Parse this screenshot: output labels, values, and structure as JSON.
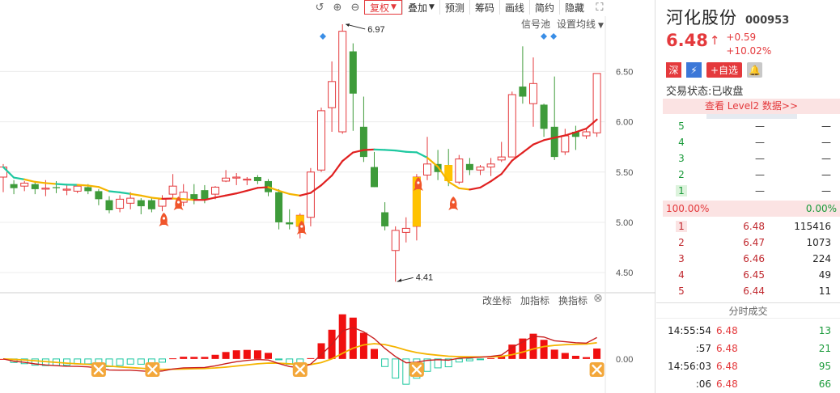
{
  "toolbar": {
    "undo_icon": "undo-icon",
    "zoom_in_icon": "zoom-in-icon",
    "zoom_out_icon": "zoom-out-icon",
    "buttons": [
      "复权",
      "叠加",
      "预测",
      "筹码",
      "画线",
      "简约",
      "隐藏"
    ],
    "fullscreen_icon": "fullscreen-icon"
  },
  "chart_links": {
    "signal_pool": "信号池",
    "ma_settings": "设置均线"
  },
  "indicator_toolbar": {
    "change_axis": "改坐标",
    "add_indicator": "加指标",
    "switch_indicator": "换指标",
    "close_icon": "close-circle-icon"
  },
  "colors": {
    "up": "#e4393c",
    "down": "#3e9b3a",
    "accent": "#e4393c",
    "ma_gold": "#f5b400",
    "ma_teal": "#1ec8a0",
    "dif": "#c81e1e",
    "dea": "#f5b400"
  },
  "chart_data": [
    {
      "type": "candlestick",
      "y_ticks": [
        "6.50",
        "6.00",
        "5.50",
        "5.00",
        "4.50"
      ],
      "ylim": [
        4.3,
        7.05
      ],
      "annotations": {
        "high": "6.97",
        "low": "4.41"
      },
      "candles": [
        {
          "o": 5.45,
          "c": 5.55,
          "h": 5.58,
          "l": 5.3
        },
        {
          "o": 5.38,
          "c": 5.34,
          "h": 5.42,
          "l": 5.28
        },
        {
          "o": 5.36,
          "c": 5.39,
          "h": 5.41,
          "l": 5.31
        },
        {
          "o": 5.38,
          "c": 5.33,
          "h": 5.4,
          "l": 5.28
        },
        {
          "o": 5.33,
          "c": 5.34,
          "h": 5.42,
          "l": 5.26
        },
        {
          "o": 5.35,
          "c": 5.34,
          "h": 5.41,
          "l": 5.29
        },
        {
          "o": 5.32,
          "c": 5.33,
          "h": 5.38,
          "l": 5.27
        },
        {
          "o": 5.31,
          "c": 5.36,
          "h": 5.37,
          "l": 5.29
        },
        {
          "o": 5.35,
          "c": 5.31,
          "h": 5.38,
          "l": 5.28
        },
        {
          "o": 5.31,
          "c": 5.23,
          "h": 5.33,
          "l": 5.17
        },
        {
          "o": 5.22,
          "c": 5.12,
          "h": 5.26,
          "l": 5.09
        },
        {
          "o": 5.14,
          "c": 5.23,
          "h": 5.27,
          "l": 5.1
        },
        {
          "o": 5.19,
          "c": 5.24,
          "h": 5.3,
          "l": 5.13
        },
        {
          "o": 5.22,
          "c": 5.16,
          "h": 5.24,
          "l": 5.08
        },
        {
          "o": 5.22,
          "c": 5.13,
          "h": 5.25,
          "l": 5.1
        },
        {
          "o": 5.16,
          "c": 5.23,
          "h": 5.27,
          "l": 5.11
        },
        {
          "o": 5.28,
          "c": 5.36,
          "h": 5.48,
          "l": 5.24
        },
        {
          "o": 5.2,
          "c": 5.3,
          "h": 5.38,
          "l": 5.16
        },
        {
          "o": 5.28,
          "c": 5.23,
          "h": 5.38,
          "l": 5.18
        },
        {
          "o": 5.32,
          "c": 5.23,
          "h": 5.37,
          "l": 5.19
        },
        {
          "o": 5.28,
          "c": 5.35,
          "h": 5.36,
          "l": 5.23
        },
        {
          "o": 5.41,
          "c": 5.44,
          "h": 5.52,
          "l": 5.4
        },
        {
          "o": 5.44,
          "c": 5.45,
          "h": 5.49,
          "l": 5.37
        },
        {
          "o": 5.42,
          "c": 5.43,
          "h": 5.45,
          "l": 5.37
        },
        {
          "o": 5.45,
          "c": 5.41,
          "h": 5.47,
          "l": 5.38
        },
        {
          "o": 5.41,
          "c": 5.3,
          "h": 5.43,
          "l": 5.26
        },
        {
          "o": 5.3,
          "c": 5.0,
          "h": 5.33,
          "l": 4.93
        },
        {
          "o": 5.0,
          "c": 4.98,
          "h": 5.13,
          "l": 4.93
        },
        {
          "o": 4.96,
          "c": 5.07,
          "h": 5.09,
          "l": 4.84
        },
        {
          "o": 5.05,
          "c": 5.5,
          "h": 5.54,
          "l": 4.96
        },
        {
          "o": 5.52,
          "c": 6.11,
          "h": 6.14,
          "l": 5.5
        },
        {
          "o": 6.14,
          "c": 6.4,
          "h": 6.6,
          "l": 5.9
        },
        {
          "o": 5.9,
          "c": 6.9,
          "h": 6.97,
          "l": 5.88
        },
        {
          "o": 6.7,
          "c": 6.28,
          "h": 6.78,
          "l": 5.91
        },
        {
          "o": 5.95,
          "c": 5.65,
          "h": 6.25,
          "l": 5.6
        },
        {
          "o": 5.55,
          "c": 5.35,
          "h": 5.7,
          "l": 5.35
        },
        {
          "o": 5.1,
          "c": 4.96,
          "h": 5.2,
          "l": 4.92
        },
        {
          "o": 4.72,
          "c": 4.92,
          "h": 4.96,
          "l": 4.41
        },
        {
          "o": 4.9,
          "c": 4.94,
          "h": 5.05,
          "l": 4.8
        },
        {
          "o": 4.96,
          "c": 5.45,
          "h": 5.48,
          "l": 4.82
        },
        {
          "o": 5.47,
          "c": 5.58,
          "h": 5.85,
          "l": 5.42
        },
        {
          "o": 5.58,
          "c": 5.5,
          "h": 5.72,
          "l": 5.42
        },
        {
          "o": 5.57,
          "c": 5.41,
          "h": 5.73,
          "l": 5.36
        },
        {
          "o": 5.4,
          "c": 5.63,
          "h": 5.67,
          "l": 5.38
        },
        {
          "o": 5.58,
          "c": 5.52,
          "h": 5.64,
          "l": 5.47
        },
        {
          "o": 5.52,
          "c": 5.55,
          "h": 5.57,
          "l": 5.47
        },
        {
          "o": 5.55,
          "c": 5.58,
          "h": 5.64,
          "l": 5.46
        },
        {
          "o": 5.62,
          "c": 5.65,
          "h": 5.8,
          "l": 5.6
        },
        {
          "o": 5.65,
          "c": 6.27,
          "h": 6.3,
          "l": 5.65
        },
        {
          "o": 6.35,
          "c": 6.25,
          "h": 6.75,
          "l": 6.18
        },
        {
          "o": 6.18,
          "c": 6.38,
          "h": 6.64,
          "l": 5.95
        },
        {
          "o": 6.17,
          "c": 5.93,
          "h": 6.18,
          "l": 5.85
        },
        {
          "o": 5.95,
          "c": 5.65,
          "h": 6.45,
          "l": 5.62
        },
        {
          "o": 5.7,
          "c": 5.86,
          "h": 5.93,
          "l": 5.67
        },
        {
          "o": 5.9,
          "c": 5.85,
          "h": 5.96,
          "l": 5.72
        },
        {
          "o": 5.86,
          "c": 5.9,
          "h": 5.93,
          "l": 5.83
        },
        {
          "o": 5.89,
          "c": 6.48,
          "h": 6.48,
          "l": 5.85
        }
      ]
    },
    {
      "type": "bar",
      "y_ticks": [
        "0.00"
      ],
      "ylim": [
        -0.32,
        0.47
      ]
    }
  ],
  "quote": {
    "name": "河化股份",
    "code": "000953",
    "price": "6.48",
    "change": "+0.59",
    "change_pct": "+10.02%",
    "tag_market": "深",
    "tag_watch": "+自选",
    "status_label": "交易状态:",
    "status_value": "已收盘",
    "level2": "查看 Level2 数据>>",
    "asks": [
      {
        "idx": "5",
        "price": "—",
        "vol": "—"
      },
      {
        "idx": "4",
        "price": "—",
        "vol": "—"
      },
      {
        "idx": "3",
        "price": "—",
        "vol": "—"
      },
      {
        "idx": "2",
        "price": "—",
        "vol": "—"
      },
      {
        "idx": "1",
        "price": "—",
        "vol": "—"
      }
    ],
    "ratio_left": "100.00%",
    "ratio_right": "0.00%",
    "bids": [
      {
        "idx": "1",
        "price": "6.48",
        "vol": "115416"
      },
      {
        "idx": "2",
        "price": "6.47",
        "vol": "1073"
      },
      {
        "idx": "3",
        "price": "6.46",
        "vol": "224"
      },
      {
        "idx": "4",
        "price": "6.45",
        "vol": "49"
      },
      {
        "idx": "5",
        "price": "6.44",
        "vol": "11"
      }
    ],
    "ticks_title": "分时成交",
    "ticks": [
      {
        "time": "14:55:54",
        "price": "6.48",
        "vol": "13"
      },
      {
        "time": ":57",
        "price": "6.48",
        "vol": "21"
      },
      {
        "time": "14:56:03",
        "price": "6.48",
        "vol": "95"
      },
      {
        "time": ":06",
        "price": "6.48",
        "vol": "66"
      }
    ]
  }
}
